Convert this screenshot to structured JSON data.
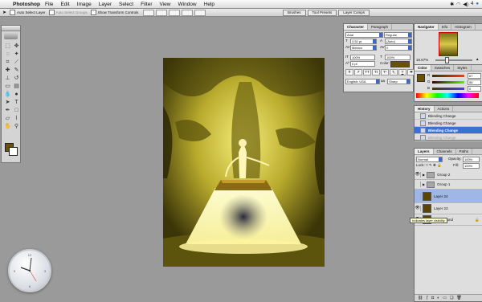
{
  "menubar": {
    "app": "Photoshop",
    "items": [
      "File",
      "Edit",
      "Image",
      "Layer",
      "Select",
      "Filter",
      "View",
      "Window",
      "Help"
    ],
    "status_number": "4"
  },
  "options": {
    "auto_select_layer": "Auto Select Layer",
    "auto_select_groups": "Auto Select Groups",
    "show_transform": "Show Transform Controls",
    "tabs": [
      "Brushes",
      "Tool Presets",
      "Layer Comps"
    ]
  },
  "character_panel": {
    "tabs": [
      "Character",
      "Paragraph"
    ],
    "font_family": "Arial",
    "font_style": "Regular",
    "font_size": "3.52 pt",
    "leading": "(Auto)",
    "kerning": "Metrics",
    "tracking": "0",
    "vscale": "100%",
    "hscale": "100%",
    "baseline": "0 pt",
    "color_label": "Color:",
    "language": "English: USA",
    "aa": "Sharp"
  },
  "navigator": {
    "tabs": [
      "Navigator",
      "Info",
      "Histogram"
    ],
    "zoom": "16.67%"
  },
  "color_panel": {
    "tabs": [
      "Color",
      "Swatches",
      "Styles"
    ],
    "r": "67",
    "g": "58",
    "b": "0",
    "labels": [
      "R",
      "G",
      "B"
    ]
  },
  "history": {
    "tabs": [
      "History",
      "Actions"
    ],
    "items": [
      {
        "label": "Blending Change",
        "state": "normal"
      },
      {
        "label": "Blending Change",
        "state": "normal"
      },
      {
        "label": "Blending Change",
        "state": "sel"
      },
      {
        "label": "Blending Change",
        "state": "dim"
      }
    ]
  },
  "layers": {
    "tabs": [
      "Layers",
      "Channels",
      "Paths"
    ],
    "blend_mode": "Normal",
    "opacity_label": "Opacity:",
    "opacity": "100%",
    "fill_label": "Fill:",
    "fill": "100%",
    "lock_label": "Lock:",
    "items": [
      {
        "name": "Group 2",
        "kind": "group"
      },
      {
        "name": "Group 1",
        "kind": "group"
      },
      {
        "name": "Layer 24",
        "kind": "layer",
        "selected": true
      },
      {
        "name": "Layer 23",
        "kind": "layer"
      },
      {
        "name": "Background",
        "kind": "layer"
      }
    ],
    "tooltip": "Indicates layer visibility"
  },
  "colors": {
    "foreground": "#6a5000",
    "highlight": "#3d6fd0"
  }
}
